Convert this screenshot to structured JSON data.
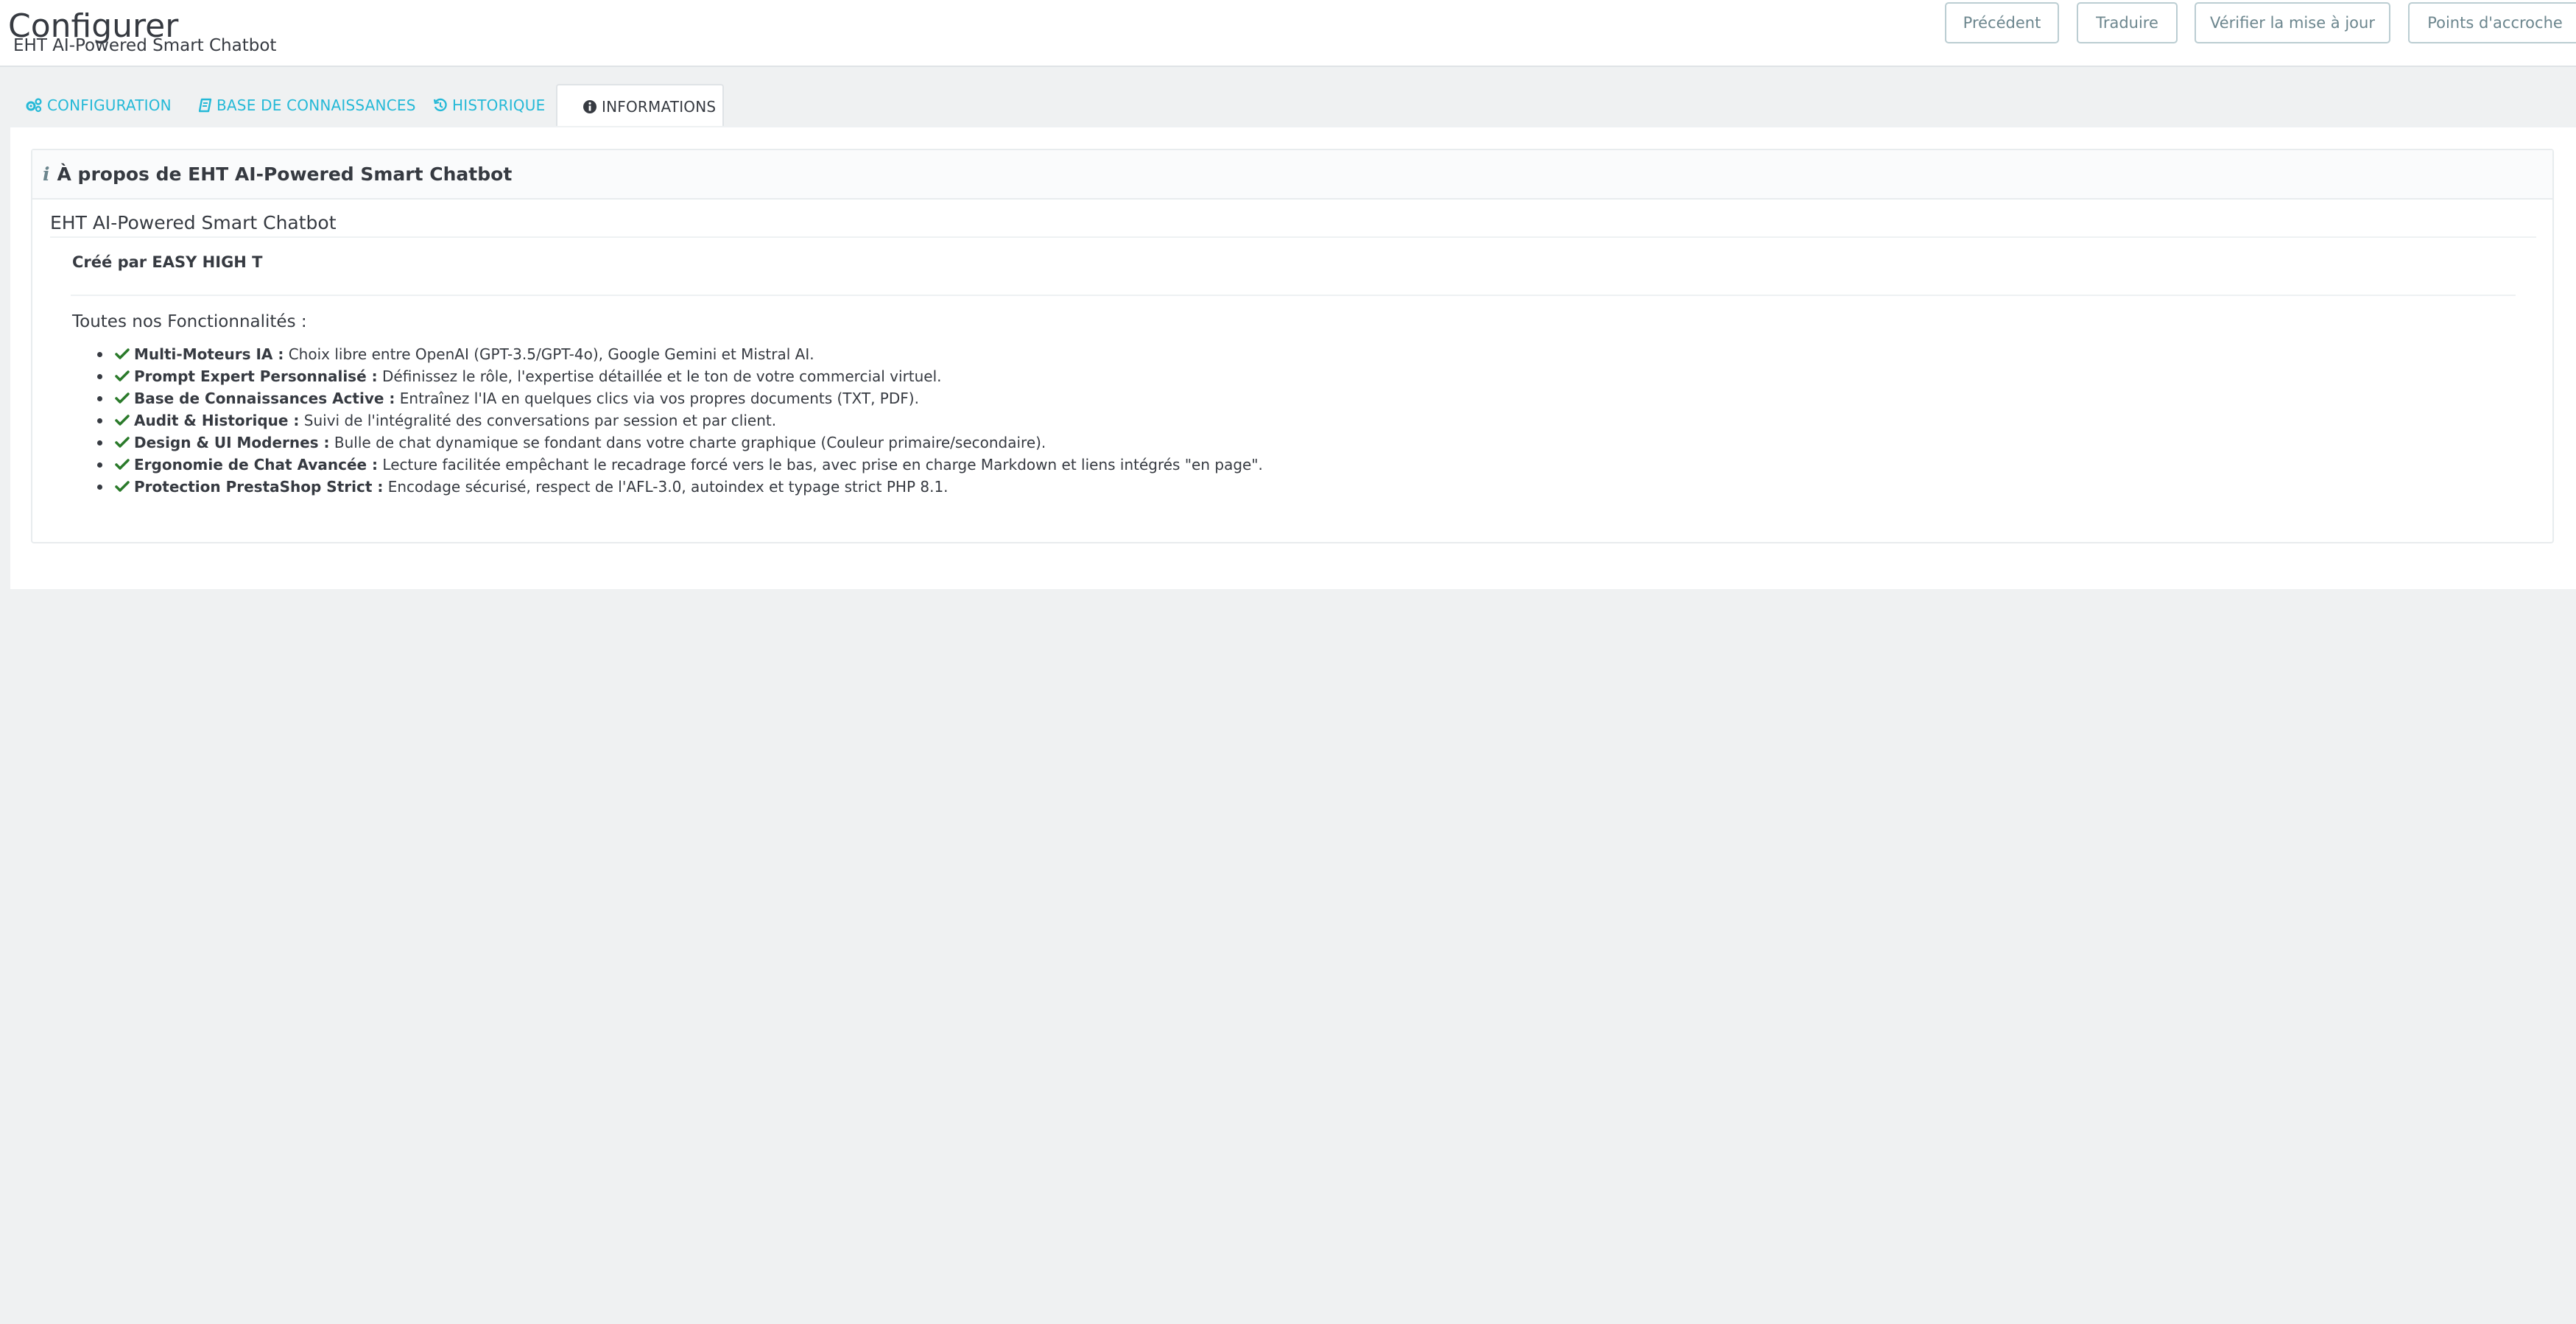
{
  "header": {
    "title": "Configurer",
    "subtitle": "EHT AI-Powered Smart Chatbot",
    "buttons": {
      "previous": "Précédent",
      "translate": "Traduire",
      "check_update": "Vérifier la mise à jour",
      "hooks": "Points d'accroche"
    }
  },
  "tabs": {
    "configuration": "CONFIGURATION",
    "knowledge_base": "BASE DE CONNAISSANCES",
    "history": "HISTORIQUE",
    "information": "INFORMATIONS",
    "active": "INFORMATIONS"
  },
  "panel": {
    "heading": "À propos de EHT AI-Powered Smart Chatbot",
    "module_name": "EHT AI-Powered Smart Chatbot",
    "created_by": "Créé par EASY HIGH T",
    "features_title": "Toutes nos Fonctionnalités :",
    "features": [
      {
        "name": "Multi-Moteurs IA :",
        "desc": "Choix libre entre OpenAI (GPT-3.5/GPT-4o), Google Gemini et Mistral AI."
      },
      {
        "name": "Prompt Expert Personnalisé :",
        "desc": "Définissez le rôle, l'expertise détaillée et le ton de votre commercial virtuel."
      },
      {
        "name": "Base de Connaissances Active :",
        "desc": "Entraînez l'IA en quelques clics via vos propres documents (TXT, PDF)."
      },
      {
        "name": "Audit & Historique :",
        "desc": "Suivi de l'intégralité des conversations par session et par client."
      },
      {
        "name": "Design & UI Modernes :",
        "desc": "Bulle de chat dynamique se fondant dans votre charte graphique (Couleur primaire/secondaire)."
      },
      {
        "name": "Ergonomie de Chat Avancée :",
        "desc": "Lecture facilitée empêchant le recadrage forcé vers le bas, avec prise en charge Markdown et liens intégrés \"en page\"."
      },
      {
        "name": "Protection PrestaShop Strict :",
        "desc": "Encodage sécurisé, respect de l'AFL-3.0, autoindex et typage strict PHP 8.1."
      }
    ]
  },
  "colors": {
    "accent": "#25b9d7",
    "check": "#2a7a2a",
    "text": "#363a41",
    "background": "#eff1f2"
  },
  "icons": {
    "configuration": "cogs-icon",
    "knowledge_base": "book-icon",
    "history": "history-icon",
    "information": "info-circle-icon",
    "feature": "check-icon"
  }
}
